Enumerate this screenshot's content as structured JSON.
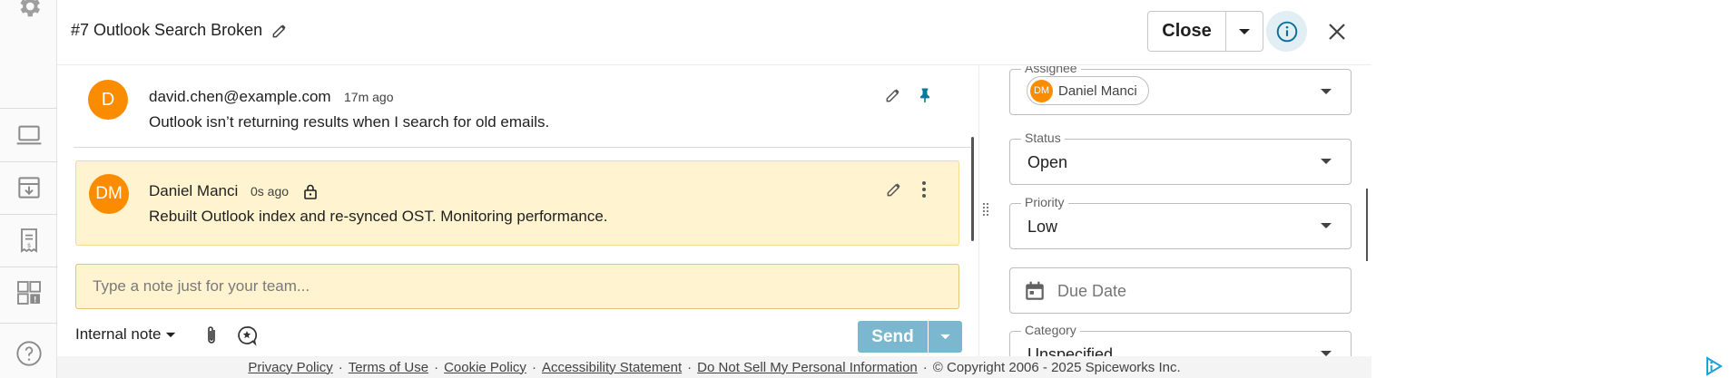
{
  "ticket": {
    "title": "#7 Outlook Search Broken",
    "close_label": "Close"
  },
  "messages": [
    {
      "avatar_initials": "D",
      "sender": "david.chen@example.com",
      "time": "17m ago",
      "body": "Outlook isn’t returning results when I search for old emails.",
      "pinned": true
    },
    {
      "avatar_initials": "DM",
      "sender": "Daniel Manci",
      "time": "0s ago",
      "body": "Rebuilt Outlook index and re-synced OST. Monitoring performance.",
      "private": true
    }
  ],
  "composer": {
    "placeholder": "Type a note just for your team...",
    "note_type": "Internal note",
    "send_label": "Send"
  },
  "panel": {
    "assignee": {
      "label": "Assignee",
      "initials": "DM",
      "name": "Daniel Manci"
    },
    "status": {
      "label": "Status",
      "value": "Open"
    },
    "priority": {
      "label": "Priority",
      "value": "Low"
    },
    "due_date": {
      "placeholder": "Due Date"
    },
    "category": {
      "label": "Category",
      "value": "Unspecified"
    }
  },
  "footer": {
    "links": [
      "Privacy Policy",
      "Terms of Use",
      "Cookie Policy",
      "Accessibility Statement",
      "Do Not Sell My Personal Information"
    ],
    "separator": "·",
    "copyright": "© Copyright 2006 - 2025 Spiceworks Inc."
  },
  "colors": {
    "accent": "#7bb8cf",
    "avatar": "#fb8c00",
    "note_bg": "#fff4cf",
    "pin": "#0b7a9a"
  },
  "icons": [
    "gear-icon",
    "laptop-icon",
    "inventory-icon",
    "invoice-icon",
    "dashboard-alert-icon",
    "help-icon",
    "pencil-icon",
    "pin-icon",
    "lock-icon",
    "more-vert-icon",
    "info-icon",
    "close-icon",
    "paperclip-icon",
    "canned-response-icon",
    "calendar-icon",
    "adchoices-icon"
  ]
}
